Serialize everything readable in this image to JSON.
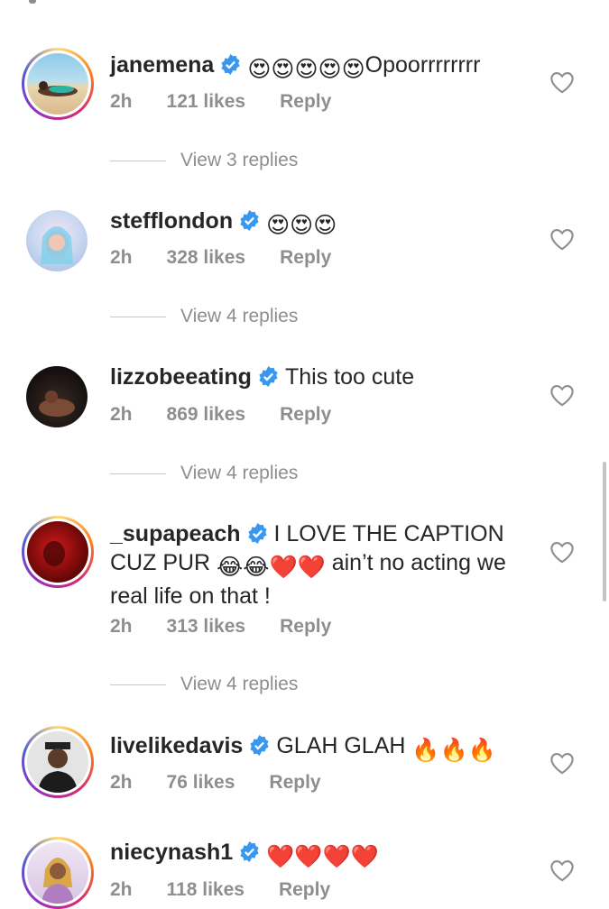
{
  "comments": [
    {
      "username": "janemena",
      "text": "Opoorrrrrrrr",
      "emoji_prefix": "😍😍😍😍😍",
      "time": "2h",
      "likes": "121 likes",
      "reply": "Reply",
      "view_replies": "View 3 replies"
    },
    {
      "username": "stefflondon",
      "text": "",
      "emoji_prefix": "😍😍😍",
      "time": "2h",
      "likes": "328 likes",
      "reply": "Reply",
      "view_replies": "View 4 replies"
    },
    {
      "username": "lizzobeeating",
      "text": "This too cute",
      "emoji_prefix": "",
      "time": "2h",
      "likes": "869 likes",
      "reply": "Reply",
      "view_replies": "View 4 replies"
    },
    {
      "username": "_supapeach",
      "text_line1": "I LOVE THE CAPTION",
      "text_line2a": "CUZ PUR",
      "text_line2_emoji": "😂😂❤️❤️",
      "text_line2b": "ain’t no acting we",
      "text_line3": "real life on that !",
      "time": "2h",
      "likes": "313 likes",
      "reply": "Reply",
      "view_replies": "View 4 replies"
    },
    {
      "username": "livelikedavis",
      "text": "GLAH GLAH",
      "emoji_suffix": "🔥🔥🔥",
      "time": "2h",
      "likes": "76 likes",
      "reply": "Reply"
    },
    {
      "username": "niecynash1",
      "text": "",
      "emoji_prefix": "❤️❤️❤️❤️",
      "time": "2h",
      "likes": "118 likes",
      "reply": "Reply"
    }
  ],
  "colors": {
    "verified": "#3897f0",
    "muted": "#8e8e8e",
    "text": "#262626"
  },
  "icons": {
    "verified": "verified-badge-icon",
    "like": "heart-outline-icon"
  }
}
